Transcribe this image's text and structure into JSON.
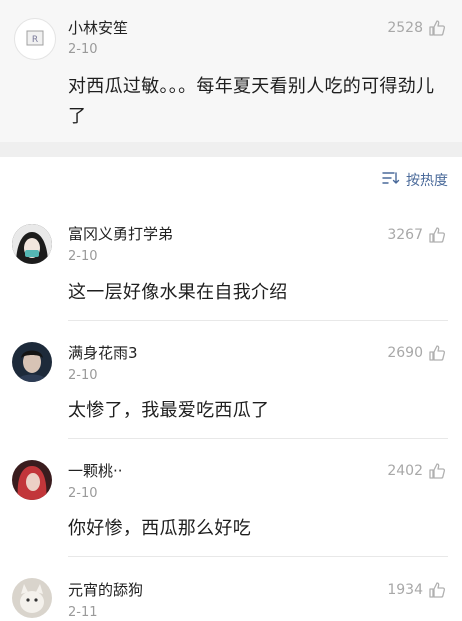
{
  "sort": {
    "label": "按热度"
  },
  "comments": [
    {
      "user": "小林安笙",
      "date": "2-10",
      "likes": "2528",
      "text": "对西瓜过敏。。。每年夏天看别人吃的可得劲儿了"
    },
    {
      "user": "富冈义勇打学弟",
      "date": "2-10",
      "likes": "3267",
      "text": "这一层好像水果在自我介绍"
    },
    {
      "user": "满身花雨3",
      "date": "2-10",
      "likes": "2690",
      "text": "太惨了，我最爱吃西瓜了"
    },
    {
      "user": "一颗桃··",
      "date": "2-10",
      "likes": "2402",
      "text": "你好惨，西瓜那么好吃"
    },
    {
      "user": "元宵的舔狗",
      "date": "2-11",
      "likes": "1934",
      "text": ""
    }
  ],
  "colors": {
    "link": "#4a6a9a",
    "muted": "#9a9a9a",
    "pinned_bg": "#f7f7f7"
  }
}
